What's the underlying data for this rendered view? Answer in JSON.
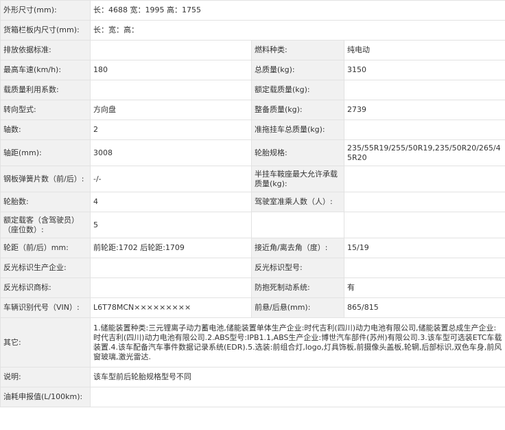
{
  "rows": [
    {
      "l1": "外形尺寸(mm):",
      "v1": "长：4688 宽：1995 高：1755"
    },
    {
      "l1": "货箱栏板内尺寸(mm):",
      "v1": "长：宽：高："
    },
    {
      "l1": "排放依据标准:",
      "v1": "",
      "l2": "燃料种类:",
      "v2": "纯电动"
    },
    {
      "l1": "最高车速(km/h):",
      "v1": "180",
      "l2": "总质量(kg):",
      "v2": "3150"
    },
    {
      "l1": "载质量利用系数:",
      "v1": "",
      "l2": "额定载质量(kg):",
      "v2": ""
    },
    {
      "l1": "转向型式:",
      "v1": "方向盘",
      "l2": "整备质量(kg):",
      "v2": "2739"
    },
    {
      "l1": "轴数:",
      "v1": "2",
      "l2": "准拖挂车总质量(kg):",
      "v2": ""
    },
    {
      "l1": "轴距(mm):",
      "v1": "3008",
      "l2": "轮胎规格:",
      "v2": "235/55R19/255/50R19,235/50R20/265/45R20"
    },
    {
      "l1": "钢板弹簧片数（前/后）:",
      "v1": "-/-",
      "l2": "半挂车鞍座最大允许承载质量(kg):",
      "v2": ""
    },
    {
      "l1": "轮胎数:",
      "v1": "4",
      "l2": "驾驶室准乘人数（人）:",
      "v2": ""
    },
    {
      "l1": "额定载客（含驾驶员）（座位数）:",
      "v1": "5",
      "l2": "",
      "v2": ""
    },
    {
      "l1": "轮距（前/后）mm:",
      "v1": "前轮距:1702 后轮距:1709",
      "l2": "接近角/离去角（度）:",
      "v2": "15/19"
    },
    {
      "l1": "反光标识生产企业:",
      "v1": "",
      "l2": "反光标识型号:",
      "v2": ""
    },
    {
      "l1": "反光标识商标:",
      "v1": "",
      "l2": "防抱死制动系统:",
      "v2": "有"
    },
    {
      "l1": "车辆识别代号（VIN）:",
      "v1": "L6T78MCN×××××××××",
      "l2": "前悬/后悬(mm):",
      "v2": "865/815"
    },
    {
      "l1": "其它:",
      "v1": "1.储能装置种类:三元锂离子动力蓄电池,储能装置单体生产企业:时代吉利(四川)动力电池有限公司,储能装置总成生产企业:时代吉利(四川)动力电池有限公司.2.ABS型号:IPB1.1,ABS生产企业:博世汽车部件(苏州)有限公司.3.该车型可选装ETC车载装置.4.该车配备汽车事件数据记录系统(EDR).5.选装:前组合灯,logo,灯具饰板,前摄像头盖板,轮辋,后部标识,双色车身,前风窗玻璃,激光雷达."
    },
    {
      "l1": "说明:",
      "v1": "该车型前后轮胎规格型号不同"
    },
    {
      "l1": "油耗申报值(L/100km):",
      "v1": ""
    }
  ]
}
